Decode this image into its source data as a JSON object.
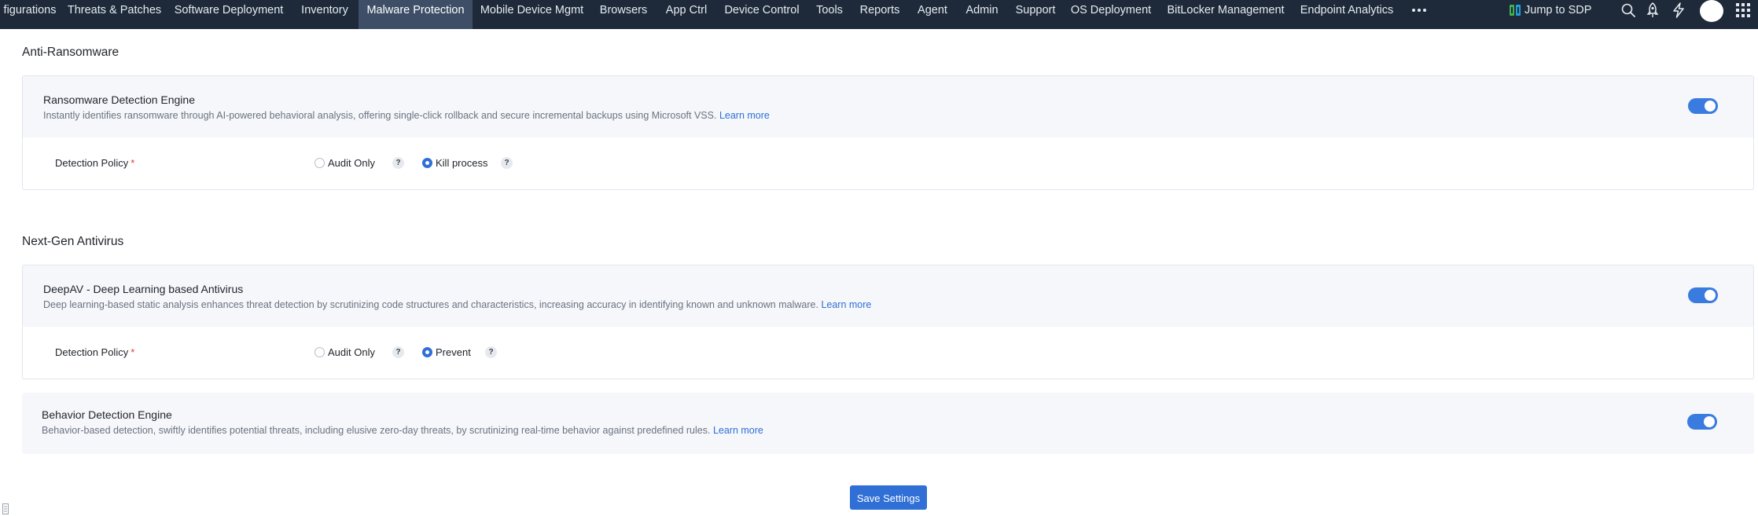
{
  "nav": {
    "items": [
      {
        "label": "figurations",
        "active": false
      },
      {
        "label": "Threats & Patches",
        "active": false
      },
      {
        "label": "Software Deployment",
        "active": false
      },
      {
        "label": "Inventory",
        "active": false
      },
      {
        "label": "Malware Protection",
        "active": true
      },
      {
        "label": "Mobile Device Mgmt",
        "active": false
      },
      {
        "label": "Browsers",
        "active": false
      },
      {
        "label": "App Ctrl",
        "active": false
      },
      {
        "label": "Device Control",
        "active": false
      },
      {
        "label": "Tools",
        "active": false
      },
      {
        "label": "Reports",
        "active": false
      },
      {
        "label": "Agent",
        "active": false
      },
      {
        "label": "Admin",
        "active": false
      },
      {
        "label": "Support",
        "active": false
      },
      {
        "label": "OS Deployment",
        "active": false
      },
      {
        "label": "BitLocker Management",
        "active": false
      },
      {
        "label": "Endpoint Analytics",
        "active": false
      }
    ],
    "more_icon": "more-horizontal-icon",
    "jump_to_sdp": "Jump to SDP",
    "icons": [
      "search-icon",
      "rocket-icon",
      "lightning-icon",
      "avatar",
      "apps-grid-icon"
    ]
  },
  "anti_ransomware": {
    "section_title": "Anti-Ransomware",
    "engine": {
      "title": "Ransomware Detection Engine",
      "description": "Instantly identifies ransomware through AI-powered behavioral analysis, offering single-click rollback and secure incremental backups using Microsoft VSS.",
      "learn_more": "Learn more",
      "enabled": true
    },
    "policy": {
      "label": "Detection Policy",
      "required_mark": "*",
      "options": [
        "Audit Only",
        "Kill process"
      ],
      "selected": "Kill process",
      "help": "?"
    }
  },
  "next_gen_av": {
    "section_title": "Next-Gen Antivirus",
    "deepav": {
      "title": "DeepAV - Deep Learning based Antivirus",
      "description": "Deep learning-based static analysis enhances threat detection by scrutinizing code structures and characteristics, increasing accuracy in identifying known and unknown malware.",
      "learn_more": "Learn more",
      "enabled": true
    },
    "policy": {
      "label": "Detection Policy",
      "required_mark": "*",
      "options": [
        "Audit Only",
        "Prevent"
      ],
      "selected": "Prevent",
      "help": "?"
    },
    "behavior": {
      "title": "Behavior Detection Engine",
      "description": "Behavior-based detection, swiftly identifies potential threats, including elusive zero-day threats, by scrutinizing real-time behavior against predefined rules.",
      "learn_more": "Learn more",
      "enabled": true
    }
  },
  "save_button": "Save Settings",
  "colors": {
    "nav_bg": "#1e2a39",
    "nav_active": "#3d4e66",
    "accent": "#2f6fd6",
    "toggle_on": "#3a7be0",
    "card_head_bg": "#f5f7fa"
  }
}
